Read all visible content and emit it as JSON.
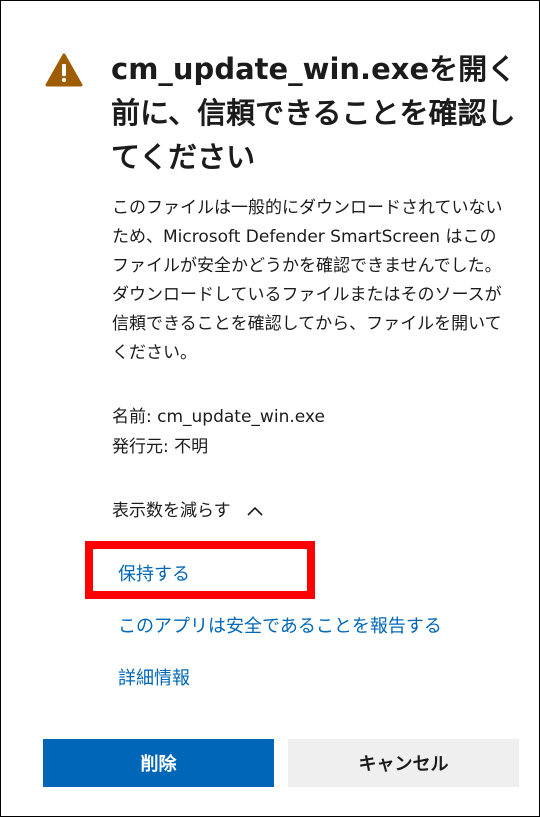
{
  "dialog": {
    "warning_icon": "warning-triangle-icon",
    "title": "cm_update_win.exeを開く前に、信頼できることを確認してください",
    "description": "このファイルは一般的にダウンロードされていないため、Microsoft Defender SmartScreen はこのファイルが安全かどうかを確認できませんでした。ダウンロードしているファイルまたはそのソースが信頼できることを確認してから、ファイルを開いてください。",
    "name_line": "名前: cm_update_win.exe",
    "publisher_line": "発行元: 不明",
    "show_less_label": "表示数を減らす",
    "keep_link": "保持する",
    "report_safe_link": "このアプリは安全であることを報告する",
    "more_info_link": "詳細情報",
    "delete_button": "削除",
    "cancel_button": "キャンセル"
  },
  "colors": {
    "accent": "#0067b8",
    "warning": "#9d5d00",
    "highlight": "#ff0000",
    "secondary_button": "#efefef"
  }
}
